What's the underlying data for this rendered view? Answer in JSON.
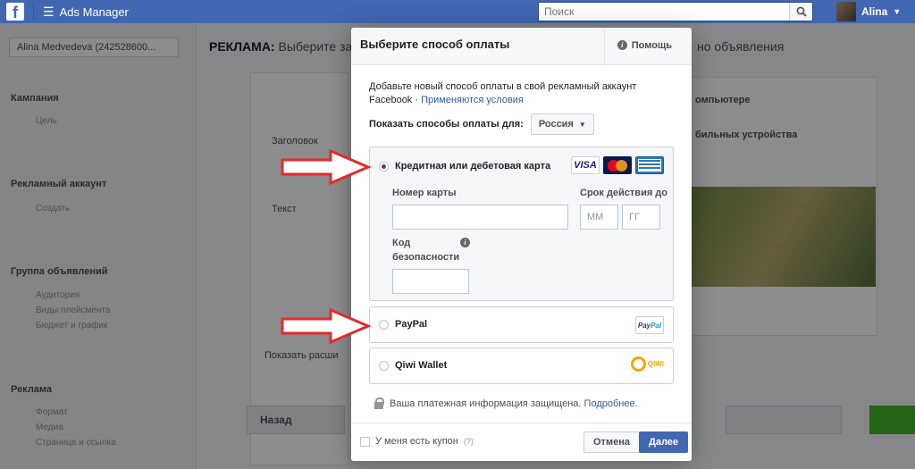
{
  "topbar": {
    "logo": "f",
    "app_title": "Ads Manager",
    "search_placeholder": "Поиск",
    "user_name": "Alina"
  },
  "background": {
    "account_selector": "Alina Medvedeva (242528600...",
    "header_prefix": "РЕКЛАМА:",
    "header_rest": " Выберите за",
    "right_header": "но объявления",
    "sections": [
      {
        "label": "Кампания",
        "sub": [
          "Цель"
        ]
      },
      {
        "label": "Рекламный аккаунт",
        "sub": [
          "Создать"
        ]
      },
      {
        "label": "Группа объявлений",
        "sub": [
          "Аудитория",
          "Виды плейсмента",
          "Бюджет и график"
        ]
      },
      {
        "label": "Реклама",
        "sub": [
          "Формат",
          "Медиа",
          "Страница и ссылка"
        ]
      }
    ],
    "right_texts": [
      "омпьютере",
      "бильных устройства"
    ],
    "left_texts": [
      "Заголовок",
      "Текст",
      "Показать расши"
    ],
    "back_button": "Назад"
  },
  "modal": {
    "title": "Выберите способ оплаты",
    "help_label": "Помощь",
    "intro_text": "Добавьте новый способ оплаты в свой рекламный аккаунт Facebook · ",
    "intro_link": "Применяются условия",
    "country_label": "Показать способы оплаты для:",
    "country_value": "Россия",
    "options": {
      "card": {
        "label": "Кредитная или дебетовая карта",
        "selected": true,
        "brands": [
          "VISA",
          "MasterCard",
          "American Express"
        ],
        "card_number_label": "Номер карты",
        "card_number_value": "",
        "expiry_label": "Срок действия до",
        "month_placeholder": "ММ",
        "year_placeholder": "ГГ",
        "cvv_label_1": "Код",
        "cvv_label_2": "безопасности",
        "cvv_value": ""
      },
      "paypal": {
        "label": "PayPal",
        "logo_1": "Pay",
        "logo_2": "Pal",
        "selected": false
      },
      "qiwi": {
        "label": "Qiwi Wallet",
        "logo": "QIWI",
        "selected": false
      }
    },
    "secure_text": "Ваша платежная информация защищена.",
    "secure_link": "Подробнее.",
    "coupon_label": "У меня есть купон",
    "coupon_help": "(?)",
    "cancel_label": "Отмена",
    "next_label": "Далее"
  },
  "colors": {
    "topbar": "#4267b2",
    "primary_button": "#4267b2",
    "arrow": "#e32b2b",
    "link": "#365899"
  }
}
